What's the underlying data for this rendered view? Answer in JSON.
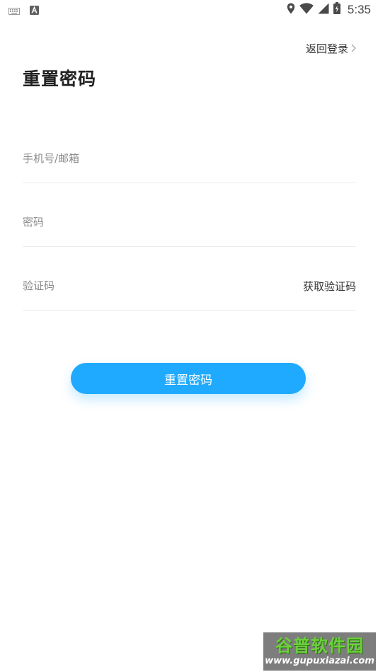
{
  "status_bar": {
    "time": "5:35",
    "left_icons": [
      "keyboard-icon",
      "font-a-icon"
    ],
    "right_icons": [
      "location-icon",
      "wifi-icon",
      "signal-icon",
      "battery-icon"
    ]
  },
  "header": {
    "back_login_label": "返回登录",
    "title": "重置密码"
  },
  "form": {
    "phone_placeholder": "手机号/邮箱",
    "password_placeholder": "密码",
    "code_placeholder": "验证码",
    "get_code_label": "获取验证码"
  },
  "submit": {
    "label": "重置密码"
  },
  "watermark": {
    "logo": "谷普软件园",
    "url": "www.gupuxiazai.com"
  },
  "colors": {
    "accent": "#1faaff",
    "divider": "#ececec",
    "text_primary": "#222222",
    "placeholder": "#8a8a8a"
  }
}
